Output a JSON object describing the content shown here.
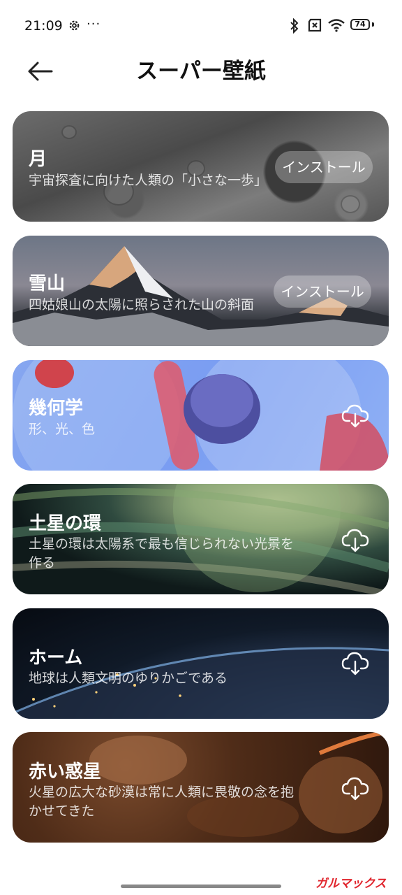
{
  "status_bar": {
    "time": "21:09",
    "dots": "···",
    "battery": "74"
  },
  "header": {
    "title": "スーパー壁紙"
  },
  "cards": [
    {
      "title": "月",
      "description": "宇宙探査に向けた人類の「小さな一歩」",
      "action": "インストール"
    },
    {
      "title": "雪山",
      "description": "四姑娘山の太陽に照らされた山の斜面",
      "action": "インストール"
    },
    {
      "title": "幾何学",
      "description": "形、光、色",
      "action": "download-icon"
    },
    {
      "title": "土星の環",
      "description": "土星の環は太陽系で最も信じられない光景を作る",
      "action": "download-icon"
    },
    {
      "title": "ホーム",
      "description": "地球は人類文明のゆりかごである",
      "action": "download-icon"
    },
    {
      "title": "赤い惑星",
      "description": "火星の広大な砂漠は常に人類に畏敬の念を抱かせてきた",
      "action": "download-icon"
    }
  ],
  "watermark": "ガルマックス"
}
